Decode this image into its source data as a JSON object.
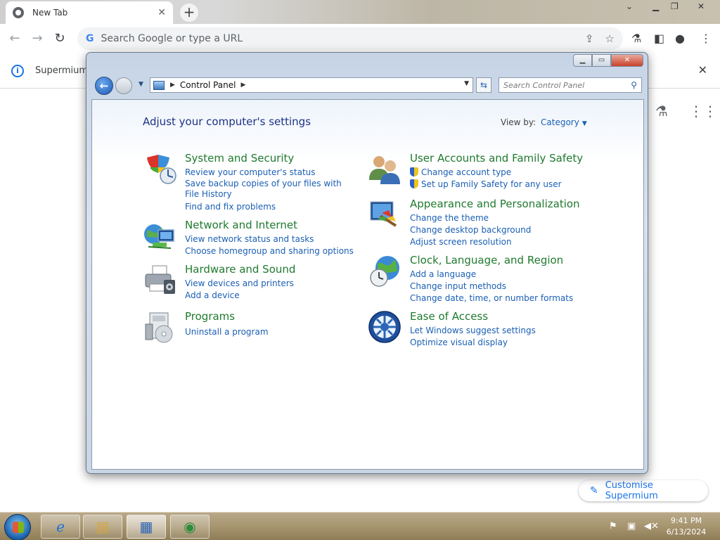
{
  "browser": {
    "tab_title": "New Tab",
    "omnibox_placeholder": "Search Google or type a URL",
    "infobar_text": "Supermium",
    "customise_label": "Customise Supermium"
  },
  "control_panel": {
    "breadcrumb": "Control Panel",
    "search_placeholder": "Search Control Panel",
    "heading": "Adjust your computer's settings",
    "view_by_label": "View by:",
    "view_by_value": "Category",
    "categories": [
      {
        "title": "System and Security",
        "icon": "shield-icon",
        "links": [
          "Review your computer's status",
          "Save backup copies of your files with File History",
          "Find and fix problems"
        ]
      },
      {
        "title": "Network and Internet",
        "icon": "globe-network-icon",
        "links": [
          "View network status and tasks",
          "Choose homegroup and sharing options"
        ]
      },
      {
        "title": "Hardware and Sound",
        "icon": "printer-icon",
        "links": [
          "View devices and printers",
          "Add a device"
        ]
      },
      {
        "title": "Programs",
        "icon": "programs-icon",
        "links": [
          "Uninstall a program"
        ]
      },
      {
        "title": "User Accounts and Family Safety",
        "icon": "users-icon",
        "links": [
          "Change account type",
          "Set up Family Safety for any user"
        ]
      },
      {
        "title": "Appearance and Personalization",
        "icon": "monitor-paint-icon",
        "links": [
          "Change the theme",
          "Change desktop background",
          "Adjust screen resolution"
        ]
      },
      {
        "title": "Clock, Language, and Region",
        "icon": "clock-globe-icon",
        "links": [
          "Add a language",
          "Change input methods",
          "Change date, time, or number formats"
        ]
      },
      {
        "title": "Ease of Access",
        "icon": "ease-of-access-icon",
        "links": [
          "Let Windows suggest settings",
          "Optimize visual display"
        ]
      }
    ]
  },
  "taskbar": {
    "time": "9:41 PM",
    "date": "6/13/2024"
  }
}
